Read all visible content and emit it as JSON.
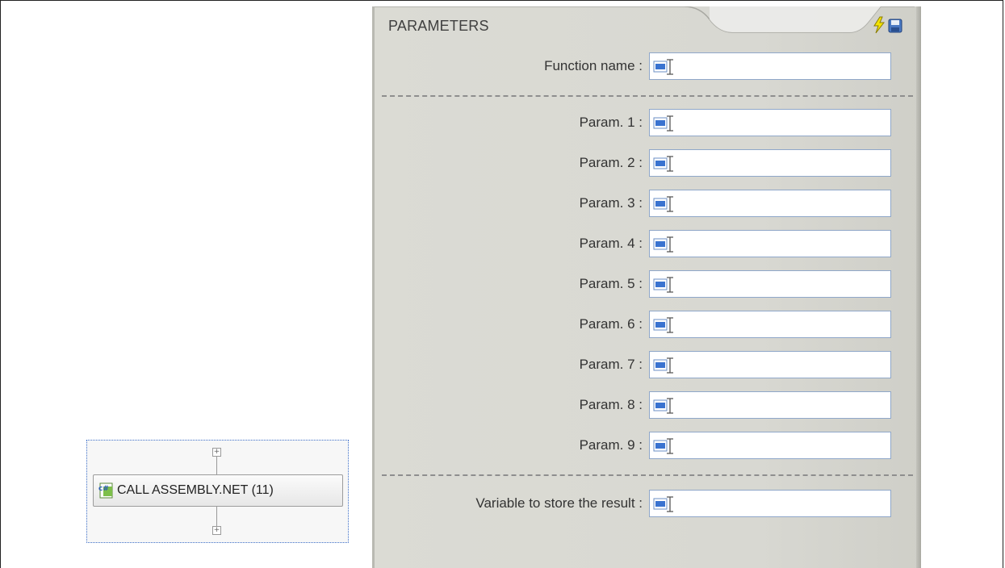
{
  "flow": {
    "node_label": "CALL ASSEMBLY.NET (11)",
    "node_icon": "csharp-file-icon",
    "top_expander_icon": "plus-box-icon",
    "bottom_expander_icon": "plus-box-icon"
  },
  "parameters_panel": {
    "title": "PARAMETERS",
    "toolbar_icons": [
      "lightning-icon",
      "save-disk-icon"
    ],
    "function_name": {
      "label": "Function name :",
      "value": ""
    },
    "params": [
      {
        "label": "Param. 1 :",
        "value": ""
      },
      {
        "label": "Param. 2 :",
        "value": ""
      },
      {
        "label": "Param. 3 :",
        "value": ""
      },
      {
        "label": "Param. 4 :",
        "value": ""
      },
      {
        "label": "Param. 5 :",
        "value": ""
      },
      {
        "label": "Param. 6 :",
        "value": ""
      },
      {
        "label": "Param. 7 :",
        "value": ""
      },
      {
        "label": "Param. 8 :",
        "value": ""
      },
      {
        "label": "Param. 9 :",
        "value": ""
      }
    ],
    "result_variable": {
      "label": "Variable to store the result :",
      "value": ""
    },
    "field_icon": "text-cursor-field-icon"
  },
  "colors": {
    "panel_bg": "#d8d8d2",
    "field_border": "#8fa7c9",
    "flow_border": "#3d6fc9"
  }
}
